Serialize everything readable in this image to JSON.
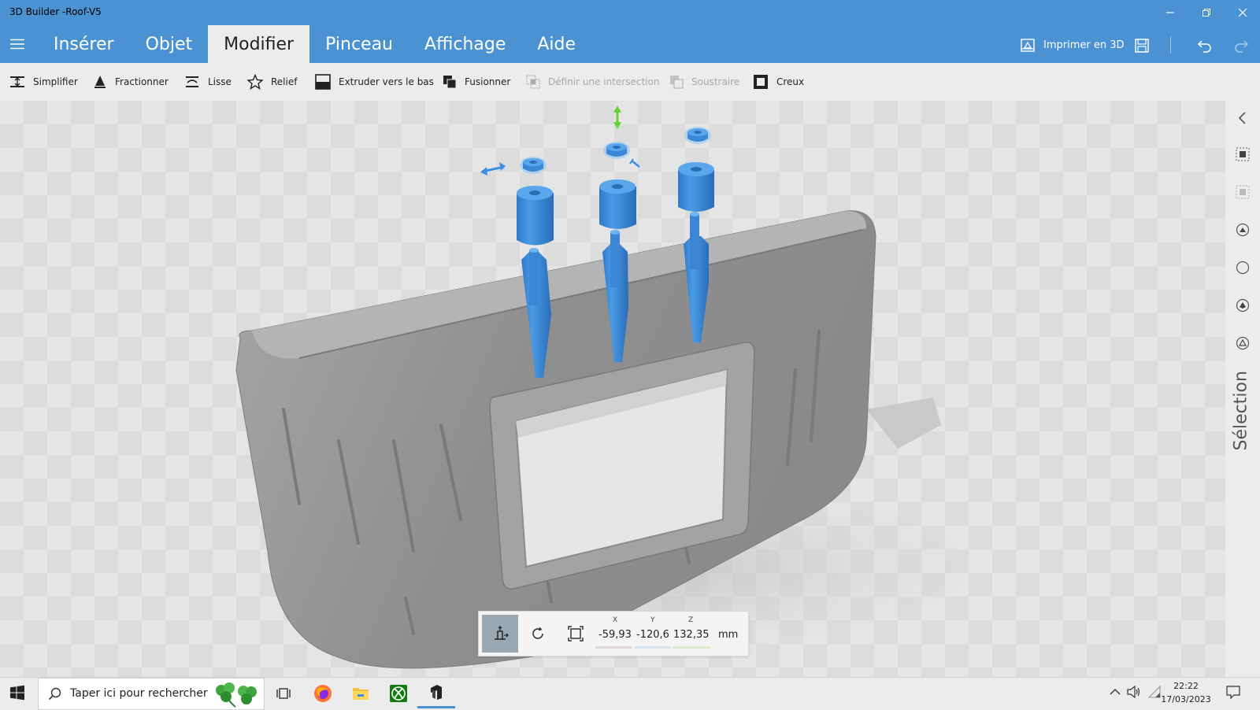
{
  "window": {
    "title": "3D Builder -Roof-V5"
  },
  "ribbon": {
    "tabs": [
      {
        "label": "Insérer"
      },
      {
        "label": "Objet"
      },
      {
        "label": "Modifier"
      },
      {
        "label": "Pinceau"
      },
      {
        "label": "Affichage"
      },
      {
        "label": "Aide"
      }
    ],
    "active_tab": "Modifier",
    "print_label": "Imprimer en 3D"
  },
  "toolbar": {
    "simplify": "Simplifier",
    "split": "Fractionner",
    "smooth": "Lisse",
    "emboss": "Relief",
    "extrude": "Extruder vers le bas",
    "merge": "Fusionner",
    "intersect": "Définir une intersection",
    "subtract": "Soustraire",
    "hollow": "Creux"
  },
  "sidebar": {
    "label": "Sélection"
  },
  "transform": {
    "x_label": "X",
    "x_value": "-59,93",
    "y_label": "Y",
    "y_value": "-120,6",
    "z_label": "Z",
    "z_value": "132,35",
    "unit": "mm"
  },
  "taskbar": {
    "search_placeholder": "Taper ici pour rechercher",
    "time": "22:22",
    "date": "17/03/2023"
  },
  "colors": {
    "accent": "#4a92d1",
    "model_selected": "#3a87d6",
    "model_gray": "#8f8f8f"
  }
}
